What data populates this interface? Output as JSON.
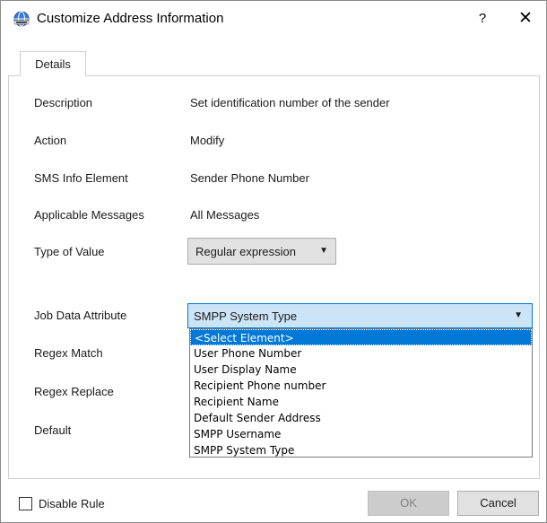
{
  "window": {
    "title": "Customize Address Information",
    "help_label": "?",
    "close_label": "✕"
  },
  "tabs": [
    {
      "label": "Details"
    }
  ],
  "form": {
    "description": {
      "label": "Description",
      "value": "Set identification number of the sender"
    },
    "action": {
      "label": "Action",
      "value": "Modify"
    },
    "sms_info_element": {
      "label": "SMS Info Element",
      "value": "Sender Phone Number"
    },
    "applicable_messages": {
      "label": "Applicable Messages",
      "value": "All Messages"
    },
    "type_of_value": {
      "label": "Type of Value",
      "value": "Regular expression"
    },
    "job_data_attribute": {
      "label": "Job Data Attribute",
      "value": "SMPP System Type",
      "options": [
        "<Select Element>",
        "User Phone Number",
        "User Display Name",
        "Recipient Phone number",
        "Recipient Name",
        "Default Sender Address",
        "SMPP Username",
        "SMPP System Type"
      ]
    },
    "regex_match": {
      "label": "Regex Match"
    },
    "regex_replace": {
      "label": "Regex Replace"
    },
    "default": {
      "label": "Default"
    }
  },
  "footer": {
    "disable_rule_label": "Disable Rule",
    "disable_rule_checked": false,
    "ok_label": "OK",
    "cancel_label": "Cancel"
  },
  "icons": {
    "app": "globe-network-icon",
    "dropdown": "chevron-down-icon"
  },
  "colors": {
    "selection": "#0078d7",
    "combo_focus_bg": "#cce4f7",
    "button_bg": "#e1e1e1"
  }
}
